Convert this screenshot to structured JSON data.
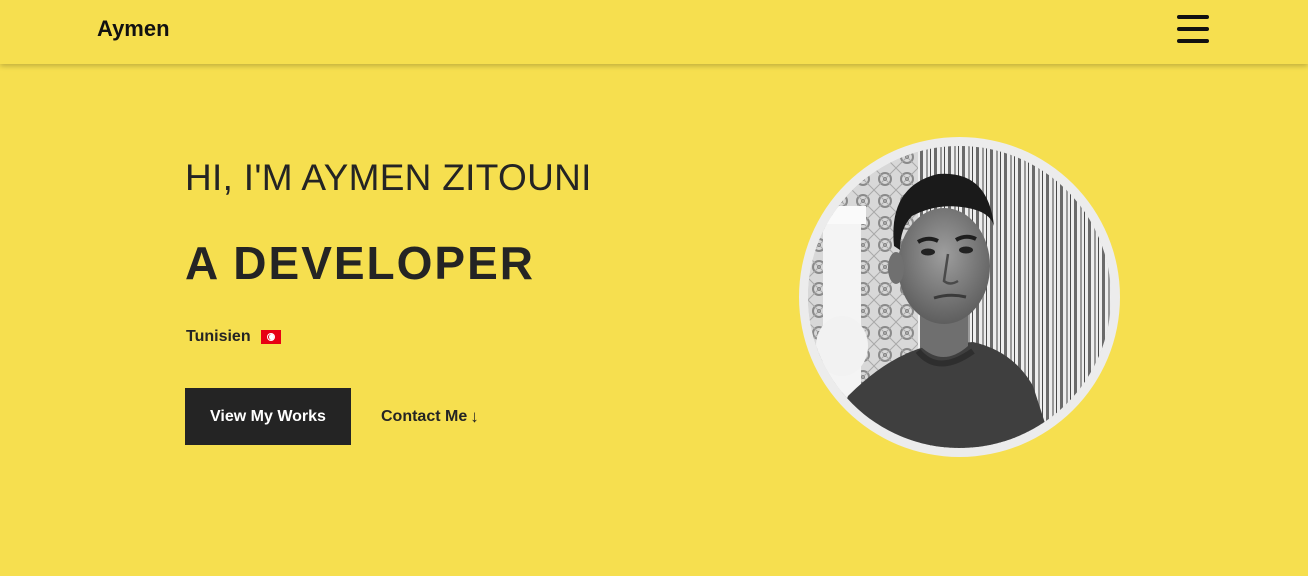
{
  "navbar": {
    "brand": "Aymen",
    "menu_icon": "hamburger-menu-icon"
  },
  "hero": {
    "greeting": "HI, I'M AYMEN ZITOUNI",
    "role": "A DEVELOPER",
    "nationality": "Tunisien",
    "flag_icon": "tunisia-flag-icon",
    "primary_button": "View My Works",
    "secondary_button": "Contact Me",
    "secondary_button_icon": "arrow-down-icon",
    "secondary_button_arrow": "↓"
  },
  "colors": {
    "background": "#f6df4f",
    "text": "#242424",
    "button_bg": "#242424",
    "button_text": "#ffffff",
    "avatar_ring": "#ececec",
    "flag_red": "#e70013"
  }
}
